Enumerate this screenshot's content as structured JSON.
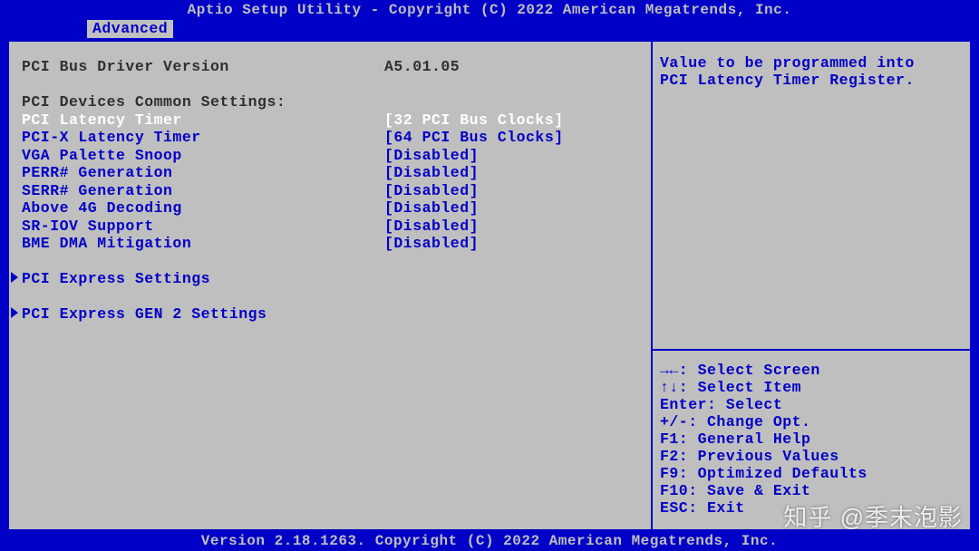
{
  "title": "Aptio Setup Utility - Copyright (C) 2022 American Megatrends, Inc.",
  "footer": "Version 2.18.1263. Copyright (C) 2022 American Megatrends, Inc.",
  "tab": {
    "label": "Advanced"
  },
  "info": {
    "version_label": "PCI Bus Driver Version",
    "version_value": "A5.01.05",
    "section_heading": "PCI Devices Common Settings:"
  },
  "options": [
    {
      "label": "PCI Latency Timer",
      "value": "[32 PCI Bus Clocks]",
      "selected": true
    },
    {
      "label": "PCI-X Latency Timer",
      "value": "[64 PCI Bus Clocks]",
      "selected": false
    },
    {
      "label": "VGA Palette Snoop",
      "value": "[Disabled]",
      "selected": false
    },
    {
      "label": "PERR# Generation",
      "value": "[Disabled]",
      "selected": false
    },
    {
      "label": "SERR# Generation",
      "value": "[Disabled]",
      "selected": false
    },
    {
      "label": "Above 4G Decoding",
      "value": "[Disabled]",
      "selected": false
    },
    {
      "label": "SR-IOV Support",
      "value": "[Disabled]",
      "selected": false
    },
    {
      "label": "BME DMA Mitigation",
      "value": "[Disabled]",
      "selected": false
    }
  ],
  "submenus": [
    {
      "label": "PCI Express Settings"
    },
    {
      "label": "PCI Express GEN 2 Settings"
    }
  ],
  "help": {
    "line1": "Value to be programmed into",
    "line2": "PCI Latency Timer Register."
  },
  "nav": {
    "h0": "→←: Select Screen",
    "h1": "↑↓: Select Item",
    "h2": "Enter: Select",
    "h3": "+/-: Change Opt.",
    "h4": "F1: General Help",
    "h5": "F2: Previous Values",
    "h6": "F9: Optimized Defaults",
    "h7": "F10: Save & Exit",
    "h8": "ESC: Exit"
  },
  "watermark": "知乎 @季末泡影"
}
